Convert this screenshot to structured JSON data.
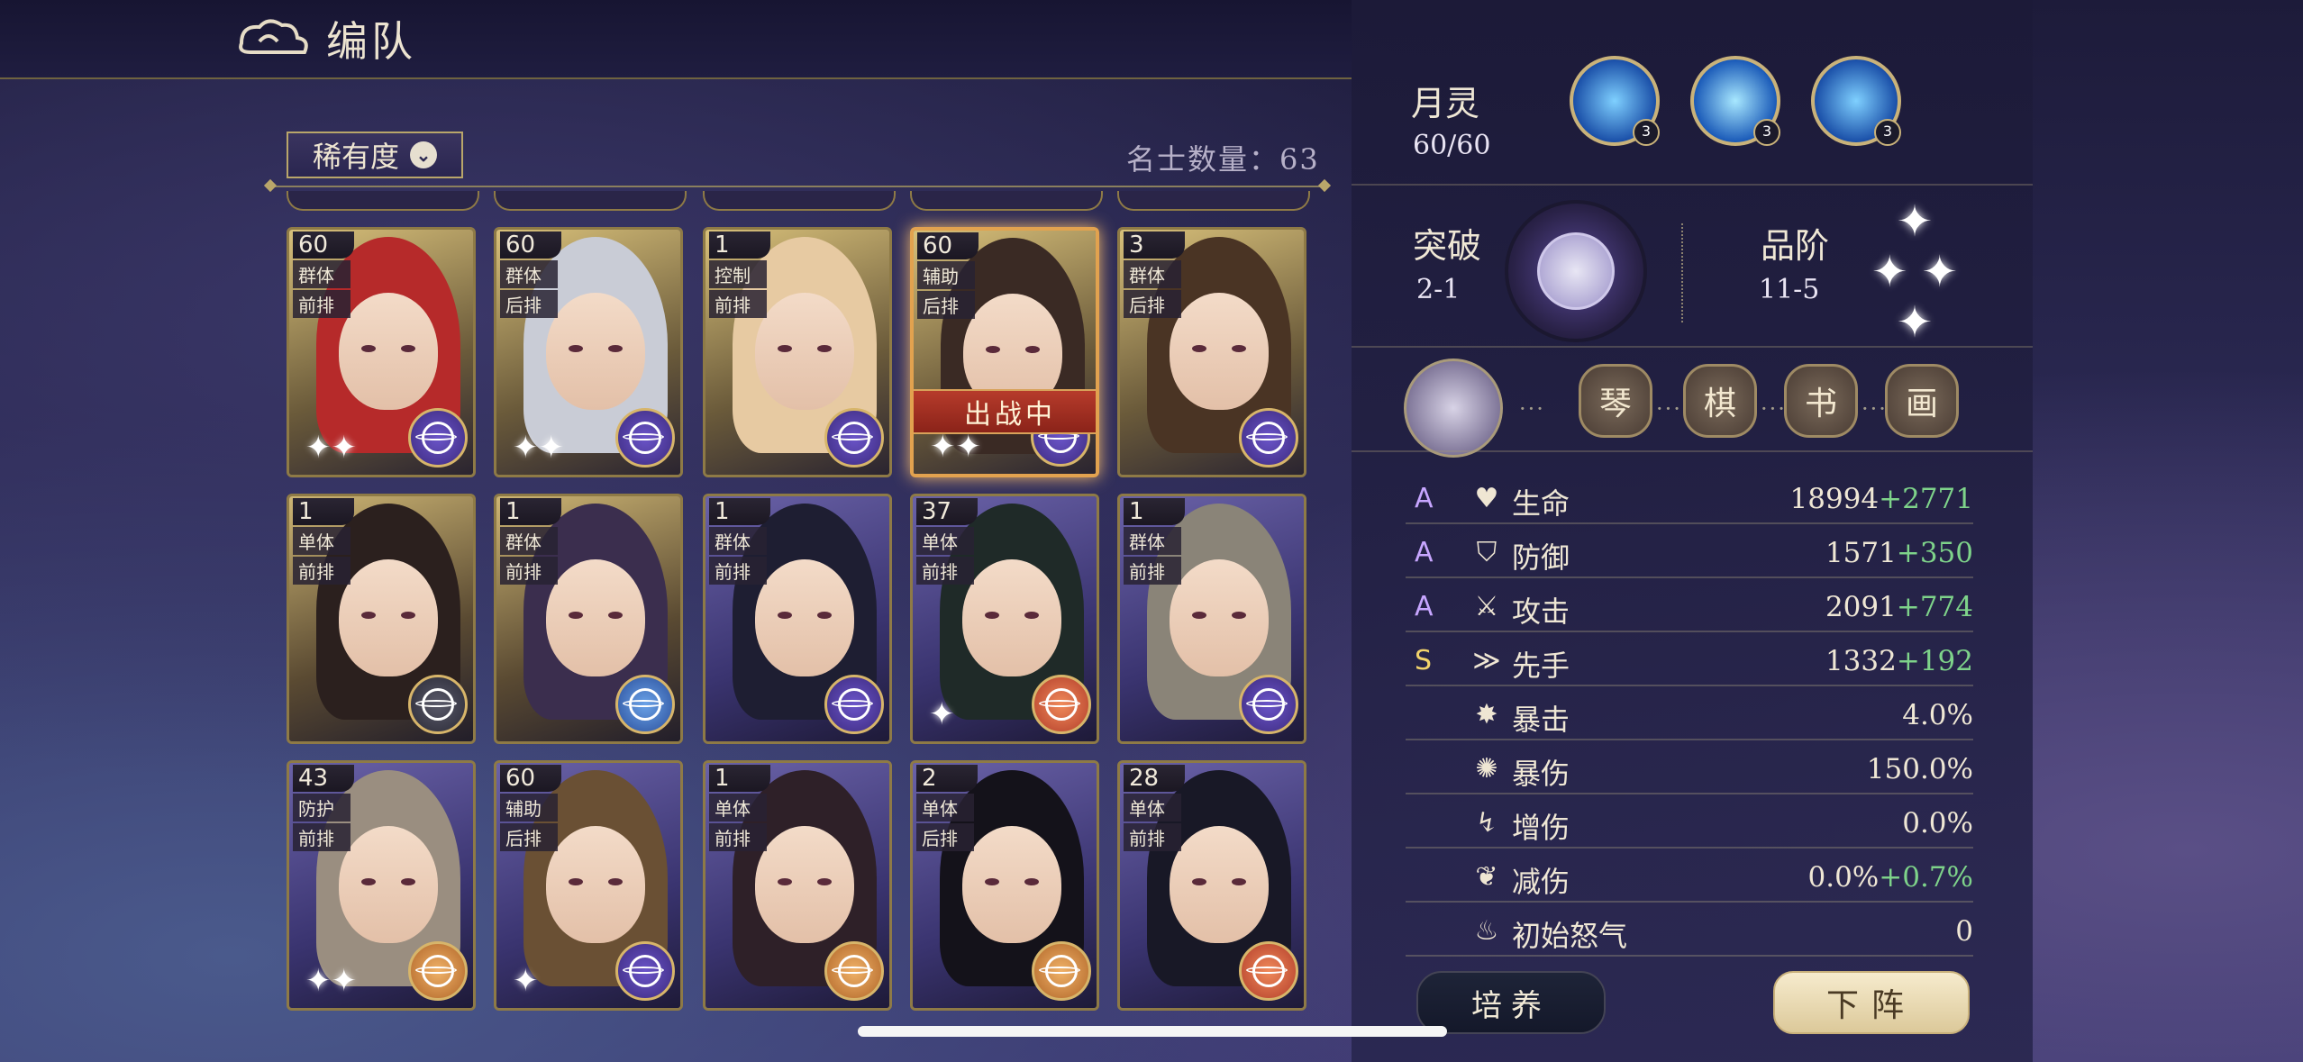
{
  "header": {
    "title": "编队"
  },
  "filter": {
    "label": "稀有度"
  },
  "roster": {
    "count_text": "名士数量：63"
  },
  "cards": [
    {
      "level": "60",
      "tags": [
        "群体",
        "前排"
      ],
      "badge": "purple",
      "hair": "#b62a2a",
      "sparkle": "✦✦"
    },
    {
      "level": "60",
      "tags": [
        "群体",
        "后排"
      ],
      "badge": "purple",
      "hair": "#c9ccd6",
      "sparkle": "✦✦"
    },
    {
      "level": "1",
      "tags": [
        "控制",
        "前排"
      ],
      "badge": "purple",
      "hair": "#e7caa2",
      "sparkle": ""
    },
    {
      "level": "60",
      "tags": [
        "辅助",
        "后排"
      ],
      "badge": "purple",
      "hair": "#3a2a24",
      "sparkle": "✦✦",
      "status": "出战中"
    },
    {
      "level": "3",
      "tags": [
        "群体",
        "后排"
      ],
      "badge": "purple",
      "hair": "#4a3424",
      "sparkle": ""
    },
    {
      "level": "1",
      "tags": [
        "单体",
        "前排"
      ],
      "badge": "dark",
      "hair": "#2b201e",
      "sparkle": ""
    },
    {
      "level": "1",
      "tags": [
        "群体",
        "前排"
      ],
      "badge": "blue",
      "hair": "#3b2e4e",
      "sparkle": ""
    },
    {
      "level": "1",
      "tags": [
        "群体",
        "前排"
      ],
      "badge": "purple",
      "hair": "#1e1e32",
      "sparkle": ""
    },
    {
      "level": "37",
      "tags": [
        "单体",
        "前排"
      ],
      "badge": "red",
      "hair": "#1f2a28",
      "sparkle": "✦"
    },
    {
      "level": "1",
      "tags": [
        "群体",
        "前排"
      ],
      "badge": "purple",
      "hair": "#8a8478",
      "sparkle": ""
    },
    {
      "level": "43",
      "tags": [
        "防护",
        "前排"
      ],
      "badge": "orange",
      "hair": "#9a8e80",
      "sparkle": "✦✦"
    },
    {
      "level": "60",
      "tags": [
        "辅助",
        "后排"
      ],
      "badge": "purple",
      "hair": "#6a5034",
      "sparkle": "✦"
    },
    {
      "level": "1",
      "tags": [
        "单体",
        "前排"
      ],
      "badge": "orange",
      "hair": "#2e2028",
      "sparkle": ""
    },
    {
      "level": "2",
      "tags": [
        "单体",
        "后排"
      ],
      "badge": "orange",
      "hair": "#14121a",
      "sparkle": ""
    },
    {
      "level": "28",
      "tags": [
        "单体",
        "前排"
      ],
      "badge": "red",
      "hair": "#181826",
      "sparkle": ""
    }
  ],
  "detail": {
    "moon_spirit": {
      "label": "月灵",
      "value": "60/60"
    },
    "skills": [
      {
        "level": "3"
      },
      {
        "level": "3"
      },
      {
        "level": "3"
      }
    ],
    "breakthrough": {
      "label": "突破",
      "value": "2-1"
    },
    "rank": {
      "label": "品阶",
      "value": "11-5"
    },
    "arts": [
      "琴",
      "棋",
      "书",
      "画"
    ],
    "stats": [
      {
        "grade": "A",
        "grade_class": "a",
        "icon": "♥",
        "name": "生命",
        "value": "18994",
        "bonus": "+2771"
      },
      {
        "grade": "A",
        "grade_class": "a",
        "icon": "⛉",
        "name": "防御",
        "value": "1571",
        "bonus": "+350"
      },
      {
        "grade": "A",
        "grade_class": "a",
        "icon": "⚔",
        "name": "攻击",
        "value": "2091",
        "bonus": "+774"
      },
      {
        "grade": "S",
        "grade_class": "s",
        "icon": "≫",
        "name": "先手",
        "value": "1332",
        "bonus": "+192"
      },
      {
        "grade": "",
        "grade_class": "",
        "icon": "✸",
        "name": "暴击",
        "value": "4.0%",
        "bonus": ""
      },
      {
        "grade": "",
        "grade_class": "",
        "icon": "✺",
        "name": "暴伤",
        "value": "150.0%",
        "bonus": ""
      },
      {
        "grade": "",
        "grade_class": "",
        "icon": "↯",
        "name": "增伤",
        "value": "0.0%",
        "bonus": ""
      },
      {
        "grade": "",
        "grade_class": "",
        "icon": "❦",
        "name": "减伤",
        "value": "0.0%",
        "bonus": "+0.7%"
      },
      {
        "grade": "",
        "grade_class": "",
        "icon": "♨",
        "name": "初始怒气",
        "value": "0",
        "bonus": ""
      }
    ],
    "train_label": "培养",
    "remove_label": "下阵"
  }
}
